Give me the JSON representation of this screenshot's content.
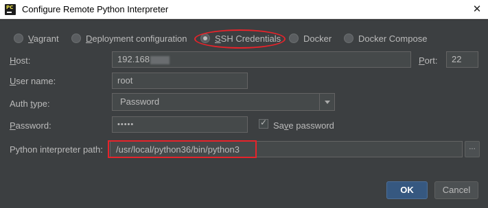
{
  "window": {
    "title": "Configure Remote Python Interpreter",
    "close_glyph": "✕"
  },
  "options": [
    {
      "pre": "",
      "mn": "V",
      "post": "agrant",
      "checked": false
    },
    {
      "pre": "",
      "mn": "D",
      "post": "eployment configuration",
      "checked": false
    },
    {
      "pre": "",
      "mn": "S",
      "post": "SH Credentials",
      "checked": true
    },
    {
      "pre": "Docker",
      "mn": "",
      "post": "",
      "checked": false
    },
    {
      "pre": "Docker Compose",
      "mn": "",
      "post": "",
      "checked": false
    }
  ],
  "form": {
    "host_label_mn": "H",
    "host_label_rest": "ost:",
    "host_value": "192.168",
    "port_label_mn": "P",
    "port_label_rest": "ort:",
    "port_value": "22",
    "user_label_mn": "U",
    "user_label_rest": "ser name:",
    "user_value": "root",
    "auth_label_pre": "Auth ",
    "auth_label_mn": "t",
    "auth_label_rest": "ype:",
    "auth_value": "Password",
    "password_label_mn": "P",
    "password_label_rest": "assword:",
    "password_value": "•••••",
    "save_password_label_pre": "Sa",
    "save_password_label_mn": "v",
    "save_password_label_rest": "e password",
    "save_password_checked": true,
    "interpreter_label": "Python interpreter path:",
    "interpreter_value": "/usr/local/python36/bin/python3",
    "browse_label": "..."
  },
  "buttons": {
    "ok": "OK",
    "cancel": "Cancel"
  },
  "colors": {
    "background": "#3c3f41",
    "highlight": "#e8232a",
    "ok_button": "#365880"
  }
}
